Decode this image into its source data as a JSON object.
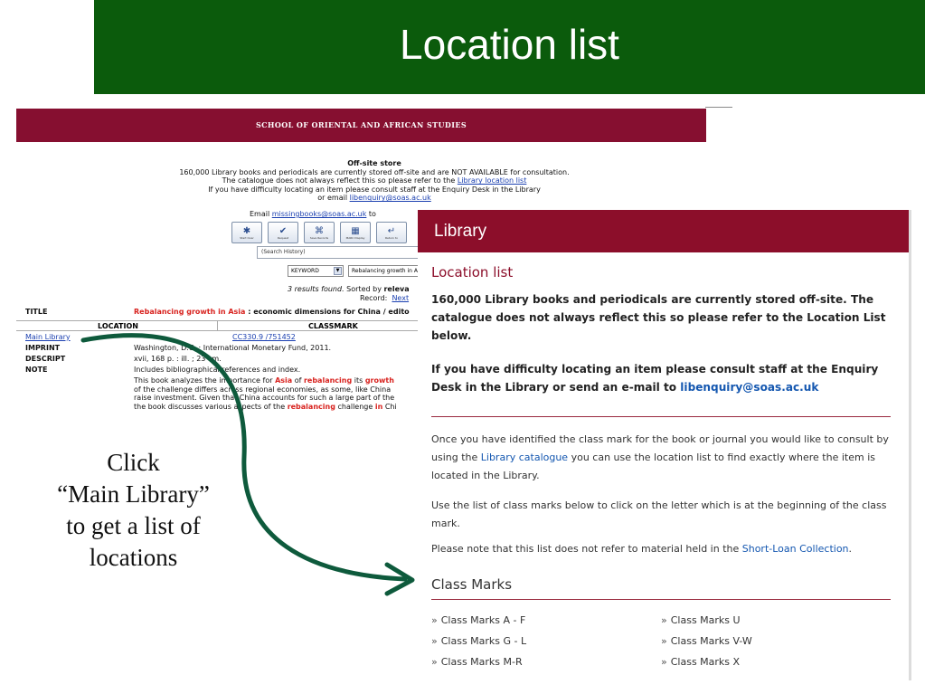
{
  "slide": {
    "title": "Location list",
    "caption_lines": [
      "Click",
      "“Main Library”",
      "to get a list of",
      "locations"
    ],
    "colors": {
      "title_bar": "#0b5b0c",
      "arrow": "#0e5a3c"
    }
  },
  "catalogue": {
    "banner": "SCHOOL OF ORIENTAL AND AFRICAN STUDIES",
    "notice": {
      "heading": "Off-site store",
      "line1": "160,000 Library books and periodicals are currently stored off-site and are NOT AVAILABLE for consultation.",
      "line2_pre": "The catalogue does not always reflect this so please refer to the ",
      "line2_link": "Library location list",
      "line3": "If you have difficulty locating an item please consult staff at the Enquiry Desk in the Library",
      "line4_pre": "or email ",
      "line4_link": "libenquiry@soas.ac.uk"
    },
    "email_pre": "Email ",
    "email_link": "missingbooks@soas.ac.uk",
    "email_post": " to",
    "toolbar": [
      {
        "glyph": "✱",
        "label": "Start Over"
      },
      {
        "glyph": "✔",
        "label": "Request"
      },
      {
        "glyph": "⌘",
        "label": "Save Records"
      },
      {
        "glyph": "▦",
        "label": "MARC Display"
      },
      {
        "glyph": "↵",
        "label": "Return to"
      }
    ],
    "search_history": "(Search History)",
    "search_type": "KEYWORD",
    "search_query": "Rebalancing growth in A",
    "results_found": "3 results found.",
    "sorted_by": " Sorted by ",
    "sorted_value": "releva",
    "record_label": "Record:",
    "record_next": "Next",
    "title_label": "TITLE",
    "title_red": "Rebalancing growth in Asia",
    "title_rest": " : economic dimensions for China / edito",
    "col_location": "LOCATION",
    "col_classmark": "CLASSMARK",
    "location_link": "Main Library",
    "classmark_link": "CC330.9 /751452",
    "imprint_label": "IMPRINT",
    "imprint_value": "Washington, D.C. : International Monetary Fund, 2011.",
    "descript_label": "DESCRIPT",
    "descript_value": "xvii, 168 p. : ill. ; 23 cm.",
    "note_label": "NOTE",
    "note_value": "Includes bibliographical references and index.",
    "note_line2_a": "This book analyzes the importance for ",
    "note_line2_b": "Asia",
    "note_line2_c": " of ",
    "note_line2_d": "rebalancing",
    "note_line2_e": " its ",
    "note_line2_f": "growth",
    "note_line3": "of the challenge differs across regional economies, as some, like China",
    "note_line4": "raise investment. Given that China accounts for such a large part of the",
    "note_line5_a": "the book discusses various aspects of the ",
    "note_line5_b": "rebalancing",
    "note_line5_c": " challenge ",
    "note_line5_d": "in",
    "note_line5_e": " Chi"
  },
  "library": {
    "header": "Library",
    "heading": "Location list",
    "intro": "160,000 Library books and periodicals are currently stored off-site.  The catalogue does not always reflect this so please refer to the Location List below.",
    "contact_pre": "If you have difficulty locating an item please consult staff at the Enquiry Desk in the Library or send an e-mail to ",
    "contact_email": "libenquiry@soas.ac.uk",
    "para1_pre": "Once you have identified the class mark for the book or journal you would like to consult by using the ",
    "para1_link": "Library catalogue",
    "para1_post": " you can use the location list to find exactly where the item is located in the Library.",
    "para2": "Use the list of class marks below to click on the letter which is at the beginning of the class mark.",
    "para3_pre": "Please note that this list does not refer to material held in the ",
    "para3_link": "Short-Loan Collection",
    "para3_post": ".",
    "classmarks_heading": "Class Marks",
    "bullet": "»",
    "classmarks_left": [
      "Class Marks A - F",
      "Class Marks G - L",
      "Class Marks M-R"
    ],
    "classmarks_right": [
      "Class Marks U",
      "Class Marks V-W",
      "Class Marks X"
    ]
  }
}
